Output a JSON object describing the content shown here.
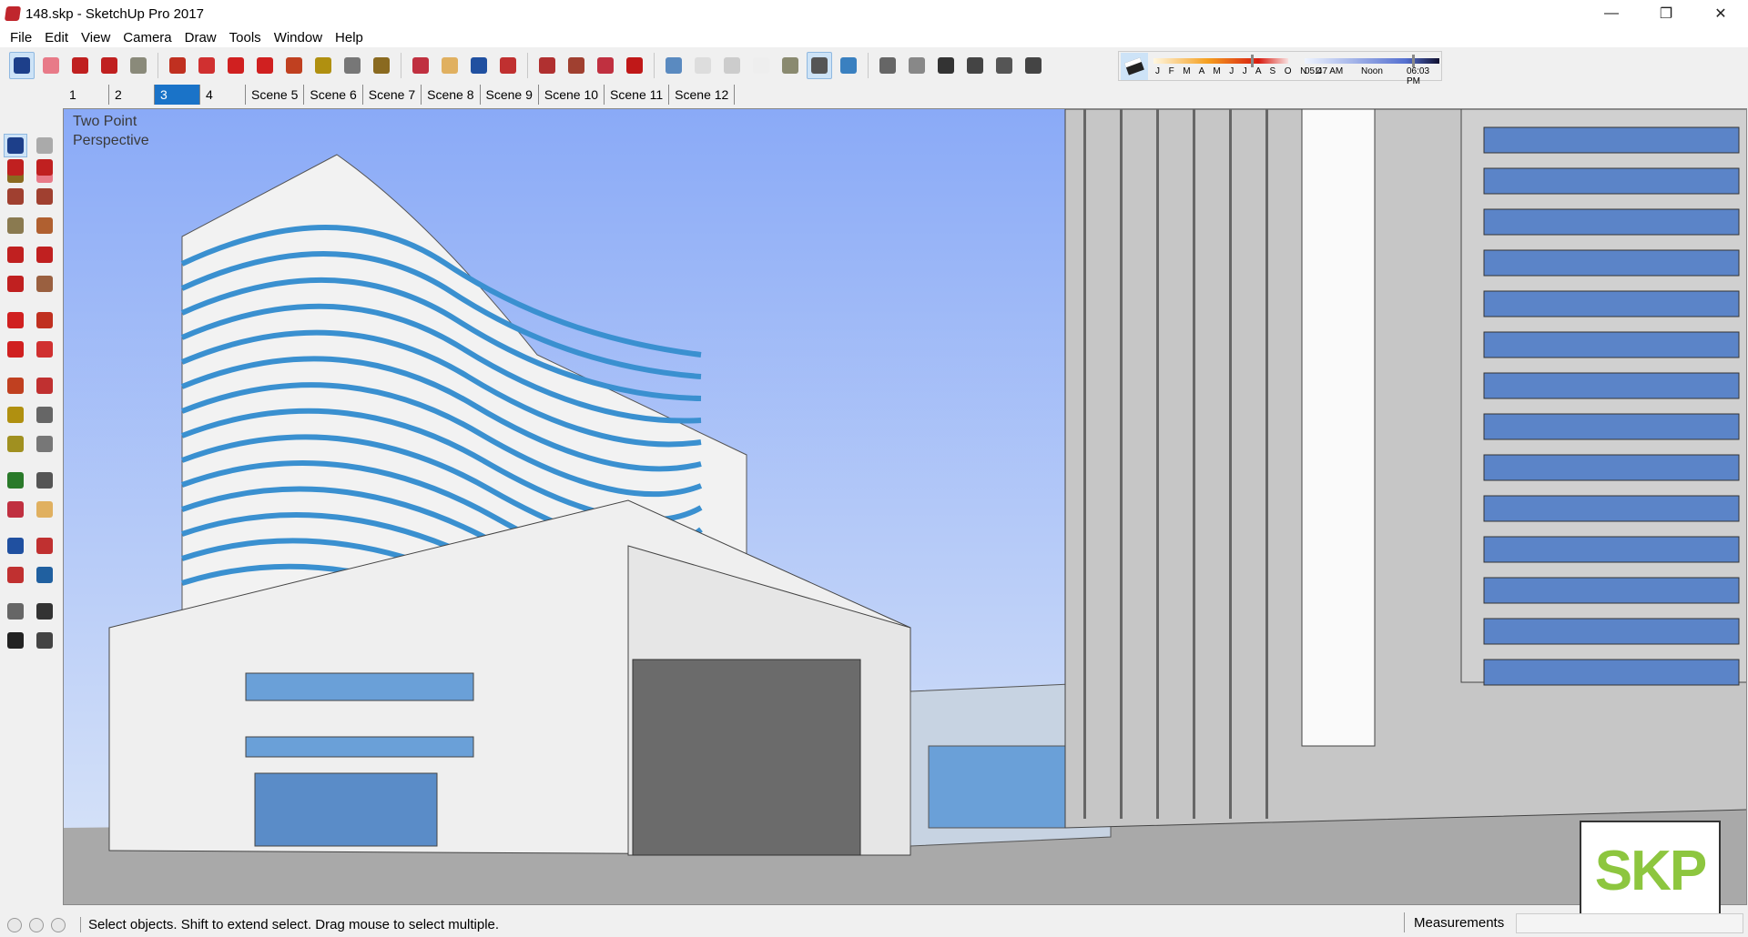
{
  "window": {
    "title": "148.skp - SketchUp Pro 2017",
    "minimize": "—",
    "maximize": "❐",
    "close": "✕"
  },
  "menu": [
    "File",
    "Edit",
    "View",
    "Camera",
    "Draw",
    "Tools",
    "Window",
    "Help"
  ],
  "toolbar": [
    {
      "name": "select-icon",
      "color": "#1d3f8a",
      "sel": true
    },
    {
      "name": "eraser-icon",
      "color": "#e87a88"
    },
    {
      "name": "pencil-icon",
      "color": "#c02020"
    },
    {
      "name": "arc-icon",
      "color": "#c02020"
    },
    {
      "name": "rectangle-icon",
      "color": "#8a8a7a"
    },
    "|",
    {
      "name": "push-pull-icon",
      "color": "#c03020"
    },
    {
      "name": "follow-me-icon",
      "color": "#d03030"
    },
    {
      "name": "move-icon",
      "color": "#d02020"
    },
    {
      "name": "rotate-icon",
      "color": "#d02020"
    },
    {
      "name": "scale-icon",
      "color": "#c04020"
    },
    {
      "name": "tape-measure-icon",
      "color": "#b09010"
    },
    {
      "name": "text-icon",
      "color": "#777"
    },
    {
      "name": "paint-bucket-icon",
      "color": "#8a6a20"
    },
    "|",
    {
      "name": "orbit-icon",
      "color": "#c03040"
    },
    {
      "name": "pan-icon",
      "color": "#e0b060"
    },
    {
      "name": "zoom-icon",
      "color": "#2050a0"
    },
    {
      "name": "zoom-extents-icon",
      "color": "#c03030"
    },
    "|",
    {
      "name": "warehouse-icon",
      "color": "#b03030"
    },
    {
      "name": "extension-warehouse-icon",
      "color": "#a04030"
    },
    {
      "name": "layout-icon",
      "color": "#c03040"
    },
    {
      "name": "ruby-icon",
      "color": "#c01818"
    },
    "|",
    {
      "name": "xray-icon",
      "color": "#5a8ac0"
    },
    {
      "name": "back-edges-icon",
      "color": "#ddd"
    },
    {
      "name": "wireframe-icon",
      "color": "#ccc"
    },
    {
      "name": "hidden-line-icon",
      "color": "#eee"
    },
    {
      "name": "shaded-icon",
      "color": "#8a8a70"
    },
    {
      "name": "shaded-textures-icon",
      "color": "#555",
      "sel": true
    },
    {
      "name": "monochrome-icon",
      "color": "#3a80c0"
    },
    "|",
    {
      "name": "iso-view-icon",
      "color": "#666"
    },
    {
      "name": "top-view-icon",
      "color": "#888"
    },
    {
      "name": "front-view-icon",
      "color": "#333"
    },
    {
      "name": "right-view-icon",
      "color": "#444"
    },
    {
      "name": "back-view-icon",
      "color": "#555"
    },
    {
      "name": "left-view-icon",
      "color": "#444"
    }
  ],
  "shadow": {
    "months": "J F M A M J J A S O N D",
    "time_start": "05:47 AM",
    "time_mid": "Noon",
    "time_end": "06:03 PM",
    "month_position": 0.72,
    "time_position": 0.8
  },
  "scenes": [
    {
      "label": "1"
    },
    {
      "label": "2"
    },
    {
      "label": "3",
      "active": true
    },
    {
      "label": "4"
    },
    {
      "label": "Scene 5"
    },
    {
      "label": "Scene 6"
    },
    {
      "label": "Scene 7"
    },
    {
      "label": "Scene 8"
    },
    {
      "label": "Scene 9"
    },
    {
      "label": "Scene 10"
    },
    {
      "label": "Scene 11"
    },
    {
      "label": "Scene 12"
    }
  ],
  "left_tools": [
    {
      "name": "select-icon",
      "color": "#1d3f8a",
      "sel": true
    },
    {
      "name": "component-icon",
      "color": "#aaa"
    },
    {
      "name": "paint-bucket-icon",
      "color": "#8a6a20"
    },
    {
      "name": "eraser-icon",
      "color": "#e87a88"
    },
    {
      "name": "line-icon",
      "color": "#c02020"
    },
    {
      "name": "freehand-icon",
      "color": "#c02020"
    },
    {
      "name": "rectangle-icon",
      "color": "#a04030"
    },
    {
      "name": "rotated-rectangle-icon",
      "color": "#a04030"
    },
    {
      "name": "circle-icon",
      "color": "#8a7a50"
    },
    {
      "name": "polygon-icon",
      "color": "#b06030"
    },
    {
      "name": "arc-icon",
      "color": "#c02020"
    },
    {
      "name": "two-point-arc-icon",
      "color": "#c02020"
    },
    {
      "name": "three-point-arc-icon",
      "color": "#c02020"
    },
    {
      "name": "pie-icon",
      "color": "#9a6040"
    },
    {
      "name": "move-icon",
      "color": "#d02020"
    },
    {
      "name": "push-pull-icon",
      "color": "#c03020"
    },
    {
      "name": "rotate-icon",
      "color": "#d02020"
    },
    {
      "name": "follow-me-icon",
      "color": "#d03030"
    },
    {
      "name": "scale-icon",
      "color": "#c04020"
    },
    {
      "name": "offset-icon",
      "color": "#c03030"
    },
    {
      "name": "tape-measure-icon",
      "color": "#b09010"
    },
    {
      "name": "dimension-icon",
      "color": "#666"
    },
    {
      "name": "protractor-icon",
      "color": "#a09020"
    },
    {
      "name": "text-icon",
      "color": "#777"
    },
    {
      "name": "axes-icon",
      "color": "#2a7a2a"
    },
    {
      "name": "3d-text-icon",
      "color": "#555"
    },
    {
      "name": "orbit-icon",
      "color": "#c03040"
    },
    {
      "name": "pan-icon",
      "color": "#e0b060"
    },
    {
      "name": "zoom-icon",
      "color": "#2050a0"
    },
    {
      "name": "zoom-window-icon",
      "color": "#c03030"
    },
    {
      "name": "zoom-extents-icon",
      "color": "#c03030"
    },
    {
      "name": "previous-view-icon",
      "color": "#2060a0"
    },
    {
      "name": "position-camera-icon",
      "color": "#666"
    },
    {
      "name": "look-around-icon",
      "color": "#333"
    },
    {
      "name": "walk-icon",
      "color": "#222"
    },
    {
      "name": "section-plane-icon",
      "color": "#444"
    }
  ],
  "viewport": {
    "camera_label_1": "Two Point",
    "camera_label_2": "Perspective",
    "sky": "#8fb0f8",
    "ground": "#a8a8a8"
  },
  "watermark": "SKP",
  "status": {
    "text": "Select objects. Shift to extend select. Drag mouse to select multiple.",
    "measurements_label": "Measurements",
    "measurements_value": ""
  }
}
